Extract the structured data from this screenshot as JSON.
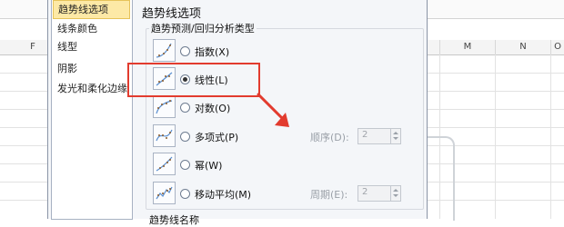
{
  "sheet": {
    "columns_left": [
      "F"
    ],
    "columns_right": [
      "M",
      "N",
      "O"
    ]
  },
  "nav": {
    "items": [
      {
        "label": "趋势线选项",
        "selected": true
      },
      {
        "label": "线条颜色"
      },
      {
        "label": "线型"
      },
      {
        "label": "阴影"
      },
      {
        "label": "发光和柔化边缘"
      }
    ]
  },
  "panel": {
    "title": "趋势线选项",
    "group_title": "趋势预测/回归分析类型",
    "options": [
      {
        "label": "指数(X)",
        "checked": false
      },
      {
        "label": "线性(L)",
        "checked": true
      },
      {
        "label": "对数(O)",
        "checked": false
      },
      {
        "label": "多项式(P)",
        "checked": false
      },
      {
        "label": "幂(W)",
        "checked": false
      },
      {
        "label": "移动平均(M)",
        "checked": false
      }
    ],
    "order_label": "顺序(D):",
    "order_value": "2",
    "period_label": "周期(E):",
    "period_value": "2",
    "bottom_title": "趋势线名称"
  },
  "colors": {
    "annotation": "#e23b2e",
    "nav_selected": "#fde9a6"
  }
}
